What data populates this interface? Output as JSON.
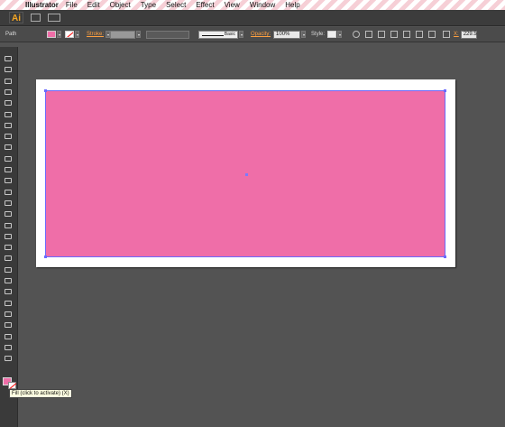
{
  "menubar": {
    "app_name": "Illustrator",
    "items": [
      "File",
      "Edit",
      "Object",
      "Type",
      "Select",
      "Effect",
      "View",
      "Window",
      "Help"
    ]
  },
  "appbar": {
    "logo": "Ai"
  },
  "control": {
    "selection_label": "Path",
    "fill_color": "#ef6ea8",
    "stroke_label": "Stroke:",
    "brush_label": "Basic",
    "opacity_label": "Opacity:",
    "opacity_value": "100%",
    "style_label": "Style:",
    "x_label": "X:",
    "x_value": "229.5"
  },
  "canvas": {
    "background": "#535353",
    "artboard_color": "#ffffff",
    "rectangle_fill": "#ef6ea8",
    "selection_color": "#6a6aff"
  },
  "tools": {
    "icons": [
      "selection-icon",
      "direct-selection-icon",
      "magic-wand-icon",
      "lasso-icon",
      "pen-icon",
      "type-icon",
      "line-segment-icon",
      "rectangle-icon",
      "paintbrush-icon",
      "pencil-icon",
      "blob-brush-icon",
      "eraser-icon",
      "rotate-icon",
      "scale-icon",
      "warp-icon",
      "free-transform-icon",
      "shape-builder-icon",
      "perspective-grid-icon",
      "mesh-icon",
      "gradient-icon",
      "eyedropper-icon",
      "blend-icon",
      "symbol-sprayer-icon",
      "column-graph-icon",
      "artboard-icon",
      "slice-icon",
      "hand-icon",
      "zoom-icon"
    ]
  },
  "tooltip": {
    "text": "Fill (click to activate) (X)"
  }
}
